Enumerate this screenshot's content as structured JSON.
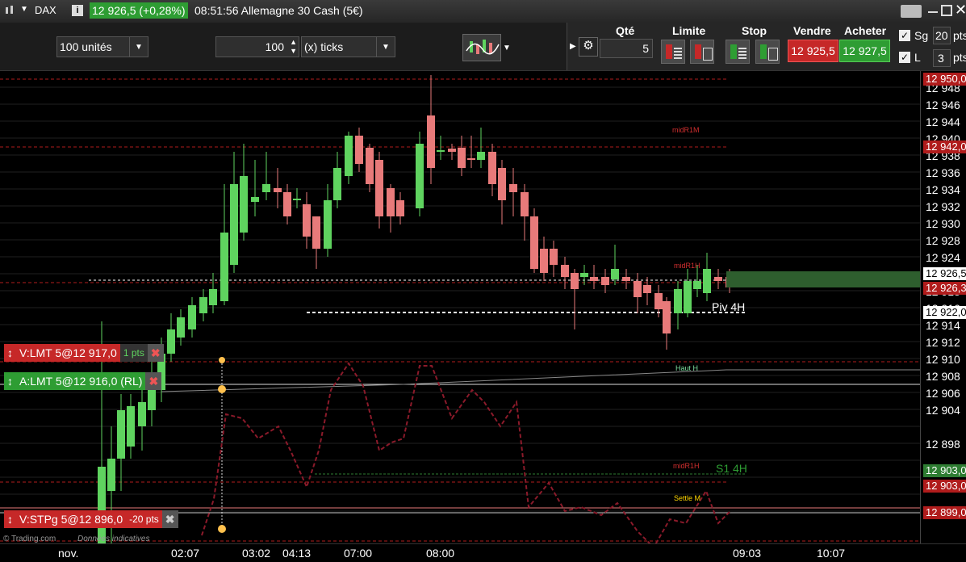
{
  "topbar": {
    "symbol": "DAX",
    "price_change": "12 926,5 (+0,28%)",
    "time_title": "08:51:56 Allemagne 30 Cash (5€)"
  },
  "toolbar": {
    "units_label": "100 unités",
    "ticks_value": "100",
    "ticks_label": "(x) ticks",
    "qty_header": "Qté",
    "qty_value": "5",
    "limit_header": "Limite",
    "stop_header": "Stop",
    "sell_header": "Vendre",
    "buy_header": "Acheter",
    "sell_price": "12 925,5",
    "buy_price": "12 927,5",
    "sg_label": "Sg",
    "sg_value": "20",
    "sg_unit": "pts",
    "l_label": "L",
    "l_value": "3",
    "l_unit": "pts"
  },
  "orders": {
    "sell_limit": {
      "label": "V:LMT 5@12 917,0",
      "pts": "1 pts"
    },
    "buy_limit": {
      "label": "A:LMT 5@12 916,0 (RL)"
    },
    "stop": {
      "label": "V:STPg 5@12 896,0",
      "pts": "-20 pts"
    }
  },
  "annotations": {
    "midR1M": "midR1M",
    "midR1H": "midR1H",
    "piv4h": "Piv 4H",
    "haut_h": "Haut H",
    "midR1H_low": "midR1H",
    "s1_4h": "S1 4H",
    "settle_m": "Settle M"
  },
  "footer": {
    "brand": "© Trading.com",
    "notice": "Données indicatives"
  },
  "axis": {
    "ticks": [
      "12 948",
      "12 946",
      "12 944",
      "12 940",
      "12 938",
      "12 936",
      "12 934",
      "12 932",
      "12 930",
      "12 928",
      "12 924",
      "12 920",
      "12 918",
      "12 916",
      "12 914",
      "12 912",
      "12 910",
      "12 908",
      "12 906",
      "12 904",
      "12 898"
    ],
    "markers": [
      {
        "label": "12 950,0",
        "bg": "#b01c1c"
      },
      {
        "label": "12 942,0",
        "bg": "#b01c1c"
      },
      {
        "label": "12 926,5",
        "bg": "#ffffff"
      },
      {
        "label": "12 926,3",
        "bg": "#b01c1c"
      },
      {
        "label": "12 922,0",
        "bg": "#ffffff"
      },
      {
        "label": "12 903,0",
        "bg": "#2e7d32"
      },
      {
        "label": "12 903,0",
        "bg": "#b01c1c"
      },
      {
        "label": "12 899,0",
        "bg": "#b01c1c"
      }
    ],
    "time_labels": [
      "nov.",
      "02:07",
      "03:02",
      "04:13",
      "07:00",
      "08:00",
      "09:03",
      "10:07"
    ]
  },
  "colors": {
    "up": "#5fd35f",
    "down": "#e87a7a",
    "sell": "#c62828",
    "buy": "#2e9d33"
  }
}
